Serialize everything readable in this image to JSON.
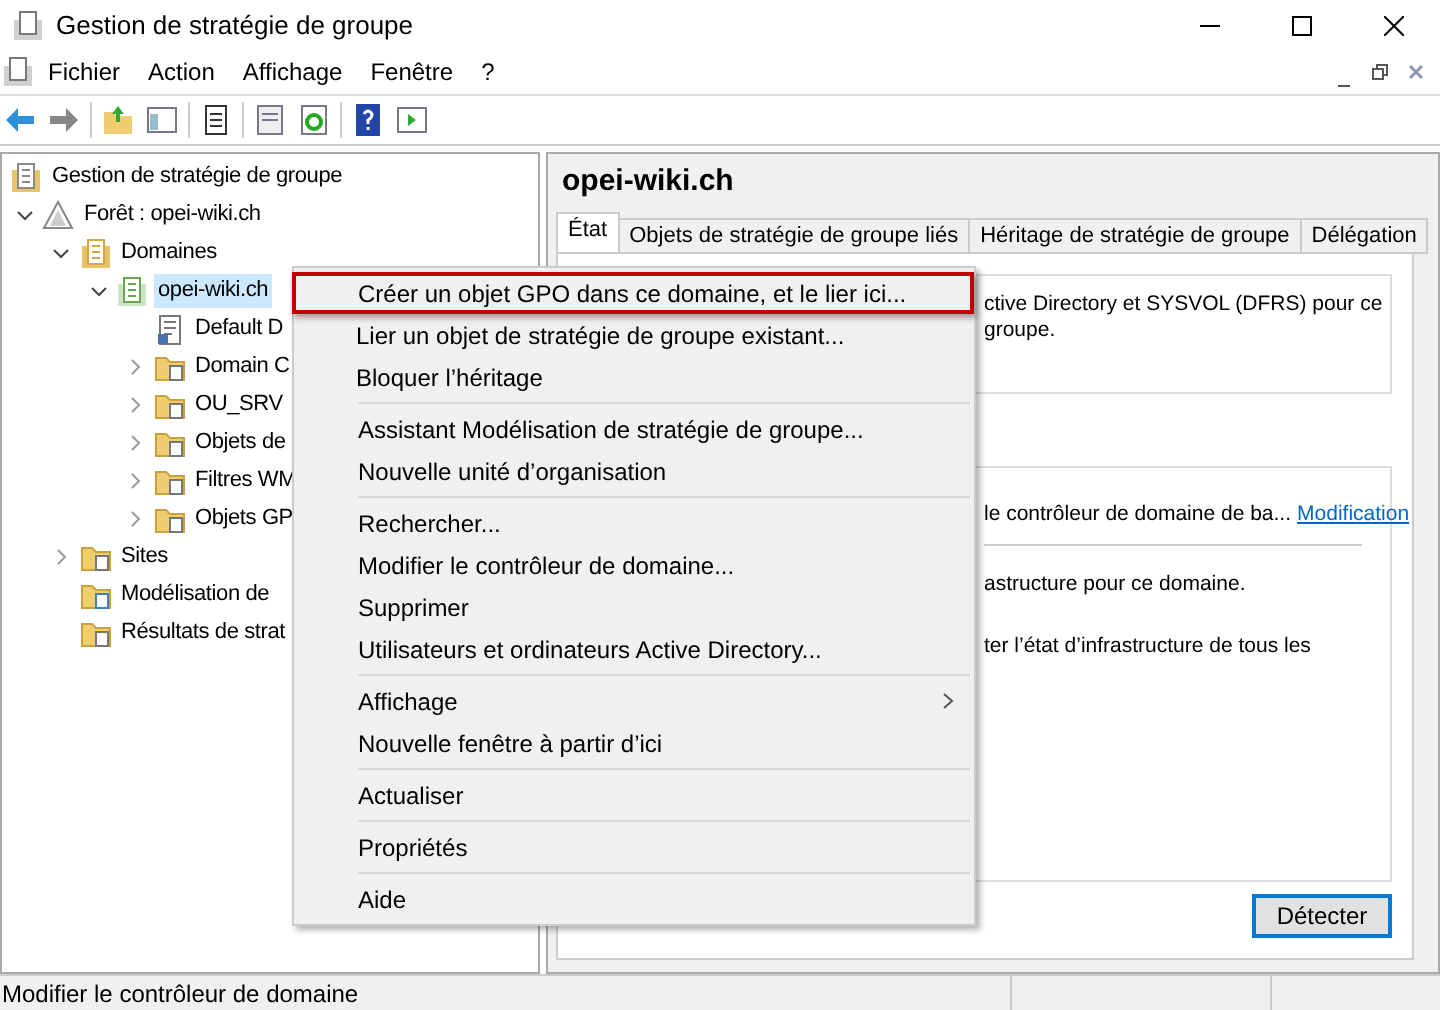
{
  "window": {
    "title": "Gestion de stratégie de groupe"
  },
  "menubar": [
    "Fichier",
    "Action",
    "Affichage",
    "Fenêtre",
    "?"
  ],
  "tree": [
    {
      "label": "Gestion de stratégie de groupe",
      "kind": "console",
      "selected": false,
      "children": [
        {
          "label": "Forêt : opei-wiki.ch",
          "kind": "forest",
          "expanded": true,
          "selected": false,
          "children": [
            {
              "label": "Domaines",
              "kind": "domains",
              "expanded": true,
              "selected": false,
              "children": [
                {
                  "label": "opei-wiki.ch",
                  "kind": "domain",
                  "expanded": true,
                  "selected": true,
                  "children": [
                    {
                      "label": "Default D",
                      "kind": "gpo",
                      "selected": false
                    },
                    {
                      "label": "Domain C",
                      "kind": "ou",
                      "expanded": false,
                      "selected": false
                    },
                    {
                      "label": "OU_SRV",
                      "kind": "ou",
                      "expanded": false,
                      "selected": false
                    },
                    {
                      "label": "Objets de",
                      "kind": "folder",
                      "expanded": false,
                      "selected": false
                    },
                    {
                      "label": "Filtres WM",
                      "kind": "folder",
                      "expanded": false,
                      "selected": false
                    },
                    {
                      "label": "Objets GP",
                      "kind": "folder",
                      "expanded": false,
                      "selected": false
                    }
                  ]
                }
              ]
            },
            {
              "label": "Sites",
              "kind": "folder",
              "expanded": false,
              "selected": false
            },
            {
              "label": "Modélisation de",
              "kind": "modeling",
              "selected": false
            },
            {
              "label": "Résultats de strat",
              "kind": "folder",
              "selected": false
            }
          ]
        }
      ]
    }
  ],
  "pane": {
    "title": "opei-wiki.ch",
    "tabs": [
      {
        "label": "État",
        "selected": true
      },
      {
        "label": "Objets de stratégie de groupe liés",
        "selected": false
      },
      {
        "label": "Héritage de stratégie de groupe",
        "selected": false
      },
      {
        "label": "Délégation",
        "selected": false
      }
    ],
    "info_lines": [
      "ctive Directory et SYSVOL (DFRS) pour ce",
      "groupe."
    ],
    "dc_text": "le contrôleur de domaine de ba...",
    "dc_link": "Modification",
    "infra_lines": [
      "astructure pour ce domaine.",
      "ter l’état d’infrastructure de tous les"
    ],
    "detect_button": "Détecter"
  },
  "context_menu": {
    "groups": [
      [
        {
          "label": "Créer un objet GPO dans ce domaine, et le lier ici...",
          "selected": true,
          "submenu": false
        },
        {
          "label": "Lier un objet de stratégie de groupe existant...",
          "selected": false,
          "submenu": false
        },
        {
          "label": "Bloquer l’héritage",
          "selected": false,
          "submenu": false
        }
      ],
      [
        {
          "label": "Assistant Modélisation de stratégie de groupe...",
          "selected": false,
          "submenu": false
        },
        {
          "label": "Nouvelle unité d’organisation",
          "selected": false,
          "submenu": false
        }
      ],
      [
        {
          "label": "Rechercher...",
          "selected": false,
          "submenu": false
        },
        {
          "label": "Modifier le contrôleur de domaine...",
          "selected": false,
          "submenu": false
        },
        {
          "label": "Supprimer",
          "selected": false,
          "submenu": false
        },
        {
          "label": "Utilisateurs et ordinateurs Active Directory...",
          "selected": false,
          "submenu": false
        }
      ],
      [
        {
          "label": "Affichage",
          "selected": false,
          "submenu": true
        },
        {
          "label": "Nouvelle fenêtre à partir d’ici",
          "selected": false,
          "submenu": false
        }
      ],
      [
        {
          "label": "Actualiser",
          "selected": false,
          "submenu": false
        }
      ],
      [
        {
          "label": "Propriétés",
          "selected": false,
          "submenu": false
        }
      ],
      [
        {
          "label": "Aide",
          "selected": false,
          "submenu": false
        }
      ]
    ]
  },
  "status_bar": "Modifier le contrôleur de domaine"
}
